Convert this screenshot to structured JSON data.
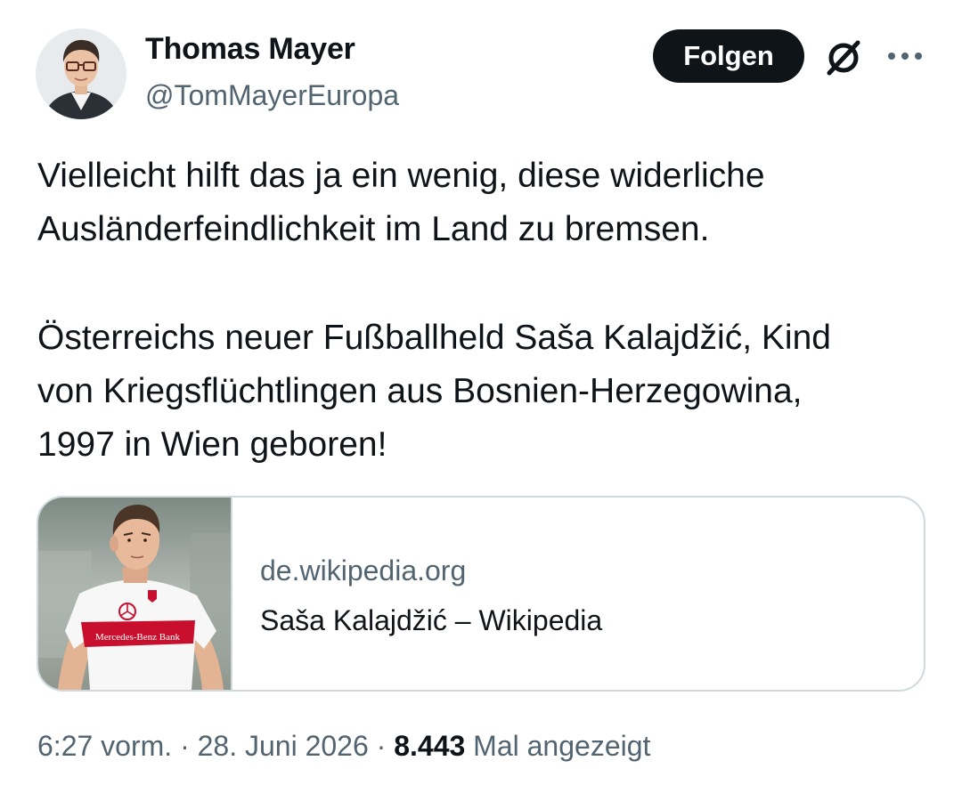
{
  "author": {
    "name": "Thomas Mayer",
    "handle": "@TomMayerEuropa",
    "avatar_icon": "profile-photo"
  },
  "actions": {
    "follow_label": "Folgen",
    "grok_icon": "slashed-circle-icon",
    "more_icon": "more-dots-icon"
  },
  "tweet": {
    "paragraph1": [
      "Vielleicht hilft das ja ein wenig, diese widerliche",
      "Ausländerfeindlichkeit im Land zu bremsen."
    ],
    "paragraph2": [
      "Österreichs neuer Fußballheld Saša Kalajdžić, Kind",
      "von Kriegsflüchtlingen aus Bosnien-Herzegowina,",
      "1997 in Wien geboren!"
    ]
  },
  "link_card": {
    "domain": "de.wikipedia.org",
    "title": "Saša Kalajdžić – Wikipedia",
    "image_text": "Mercedes-Benz Bank"
  },
  "meta": {
    "time": "6:27 vorm.",
    "separator": "·",
    "date": "28. Juni 2026",
    "views_count": "8.443",
    "views_label": "Mal angezeigt"
  },
  "colors": {
    "text_primary": "#0f1419",
    "text_secondary": "#536471",
    "border": "#cfd9de",
    "button_bg": "#0f1419",
    "jersey_red": "#c8102e"
  }
}
